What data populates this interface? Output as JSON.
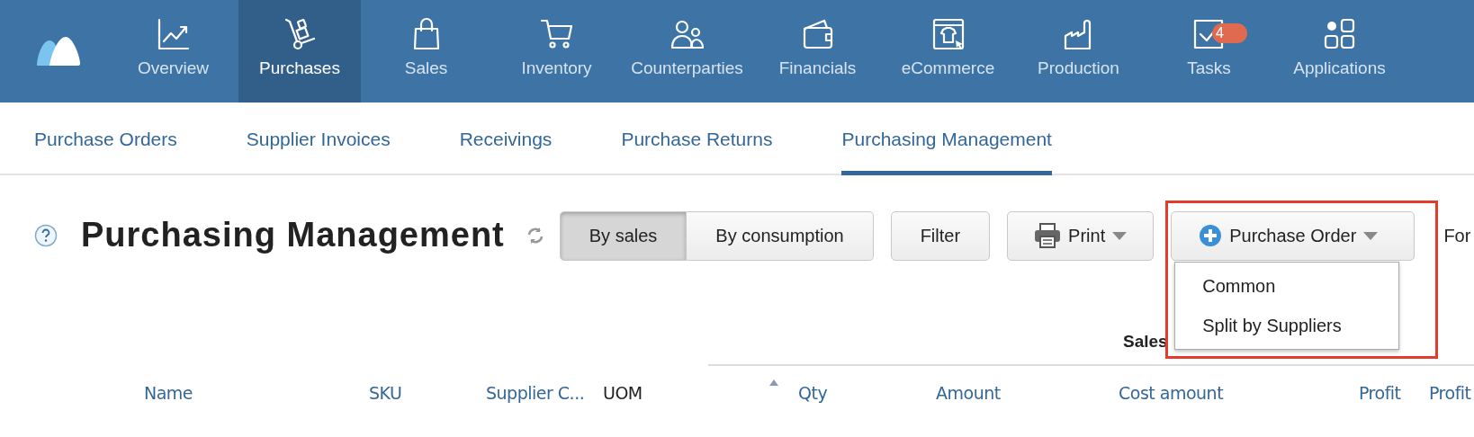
{
  "top_nav": {
    "items": [
      {
        "label": "Overview",
        "selected": false
      },
      {
        "label": "Purchases",
        "selected": true
      },
      {
        "label": "Sales",
        "selected": false
      },
      {
        "label": "Inventory",
        "selected": false
      },
      {
        "label": "Counterparties",
        "selected": false
      },
      {
        "label": "Financials",
        "selected": false
      },
      {
        "label": "eCommerce",
        "selected": false
      },
      {
        "label": "Production",
        "selected": false
      },
      {
        "label": "Tasks",
        "selected": false,
        "badge": "4"
      },
      {
        "label": "Applications",
        "selected": false
      }
    ]
  },
  "sub_nav": {
    "tabs": [
      {
        "label": "Purchase Orders",
        "selected": false
      },
      {
        "label": "Supplier Invoices",
        "selected": false
      },
      {
        "label": "Receivings",
        "selected": false
      },
      {
        "label": "Purchase Returns",
        "selected": false
      },
      {
        "label": "Purchasing Management",
        "selected": true
      }
    ]
  },
  "page": {
    "title": "Purchasing Management",
    "mode_toggle": [
      {
        "label": "By sales",
        "selected": true
      },
      {
        "label": "By consumption",
        "selected": false
      }
    ],
    "filter_button": "Filter",
    "print_button": "Print",
    "purchase_order_button": {
      "label": "Purchase Order",
      "highlighted": true,
      "expanded": true,
      "menu": [
        "Common",
        "Split by Suppliers"
      ]
    },
    "cut_label": "For"
  },
  "table": {
    "group_header": "Sales",
    "columns": [
      {
        "label": "Name",
        "sortable": true,
        "sorted": false
      },
      {
        "label": "SKU",
        "sortable": true,
        "sorted": false
      },
      {
        "label": "Supplier C...",
        "sortable": true,
        "sorted": false
      },
      {
        "label": "UOM",
        "sortable": false,
        "sorted": false
      },
      {
        "label": "Qty",
        "sortable": true,
        "sorted": true
      },
      {
        "label": "Amount",
        "sortable": true,
        "sorted": false
      },
      {
        "label": "Cost amount",
        "sortable": true,
        "sorted": false
      },
      {
        "label": "Profit",
        "sortable": true,
        "sorted": false
      },
      {
        "label": "Profit",
        "sortable": true,
        "sorted": false
      }
    ]
  }
}
